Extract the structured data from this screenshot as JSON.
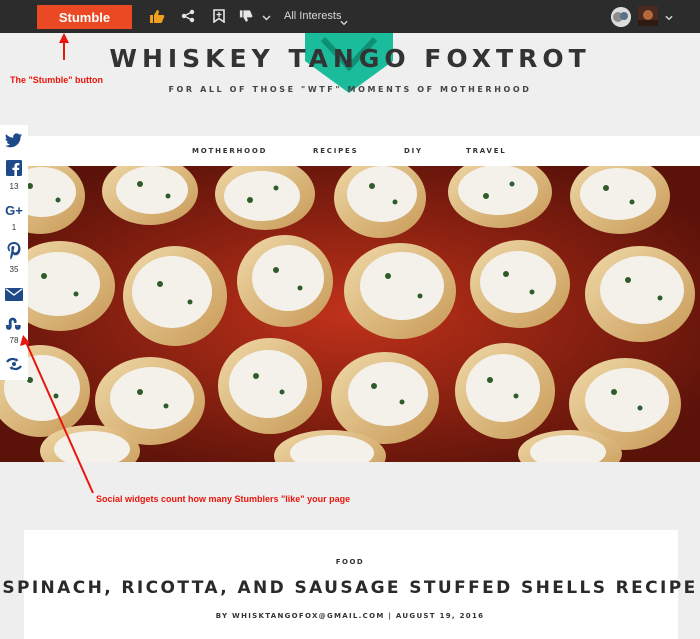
{
  "toolbar": {
    "stumble_label": "Stumble",
    "interests_label": "All Interests",
    "accent_color": "#eb4924",
    "icons": [
      "thumbs-up-icon",
      "share-icon",
      "bookmark-icon",
      "thumbs-down-icon",
      "chevron-down-icon"
    ]
  },
  "site": {
    "title": "WHISKEY TANGO FOXTROT",
    "tagline": "FOR ALL OF THOSE \"WTF\" MOMENTS OF MOTHERHOOD",
    "logo_color": "#1abc9c",
    "nav": [
      "MOTHERHOOD",
      "RECIPES",
      "DIY",
      "TRAVEL"
    ]
  },
  "hero": {
    "image": "spinach ricotta stuffed shells"
  },
  "social": {
    "items": [
      {
        "icon": "twitter-icon",
        "count": ""
      },
      {
        "icon": "facebook-icon",
        "count": "13"
      },
      {
        "icon": "google-plus-icon",
        "count": "1"
      },
      {
        "icon": "pinterest-icon",
        "count": "35"
      },
      {
        "icon": "email-icon",
        "count": ""
      },
      {
        "icon": "stumbleupon-icon",
        "count": "78"
      },
      {
        "icon": "more-share-icon",
        "count": ""
      }
    ]
  },
  "annotations": {
    "stumble": "The \"Stumble\" button",
    "social": "Social widgets count how many Stumblers \"like\" your page",
    "color": "#e8160c"
  },
  "article": {
    "category": "FOOD",
    "title": "SPINACH, RICOTTA, AND SAUSAGE STUFFED SHELLS RECIPE",
    "meta": "BY WHISKTANGOFOX@GMAIL.COM | AUGUST 19, 2016"
  }
}
